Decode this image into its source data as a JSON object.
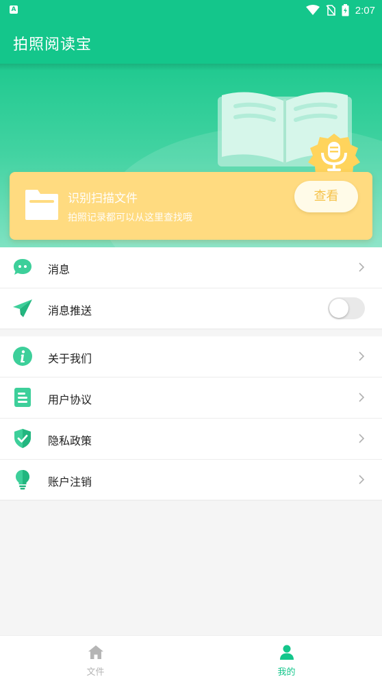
{
  "status_bar": {
    "time": "2:07"
  },
  "app": {
    "title": "拍照阅读宝"
  },
  "file_card": {
    "title": "识别扫描文件",
    "subtitle": "拍照记录都可以从这里查找哦",
    "button_label": "查看"
  },
  "menu_group_1": [
    {
      "label": "消息",
      "icon": "chat-bubble-icon",
      "control": "chevron"
    },
    {
      "label": "消息推送",
      "icon": "paper-plane-icon",
      "control": "toggle",
      "toggle_on": false
    }
  ],
  "menu_group_2": [
    {
      "label": "关于我们",
      "icon": "info-icon",
      "control": "chevron"
    },
    {
      "label": "用户协议",
      "icon": "document-icon",
      "control": "chevron"
    },
    {
      "label": "隐私政策",
      "icon": "shield-check-icon",
      "control": "chevron"
    },
    {
      "label": "账户注销",
      "icon": "lightbulb-icon",
      "control": "chevron"
    }
  ],
  "bottom_nav": [
    {
      "label": "文件",
      "icon": "home-icon",
      "active": false
    },
    {
      "label": "我的",
      "icon": "user-icon",
      "active": true
    }
  ],
  "colors": {
    "primary": "#14c68b",
    "card": "#ffdb80",
    "button_text": "#f5c24a"
  }
}
